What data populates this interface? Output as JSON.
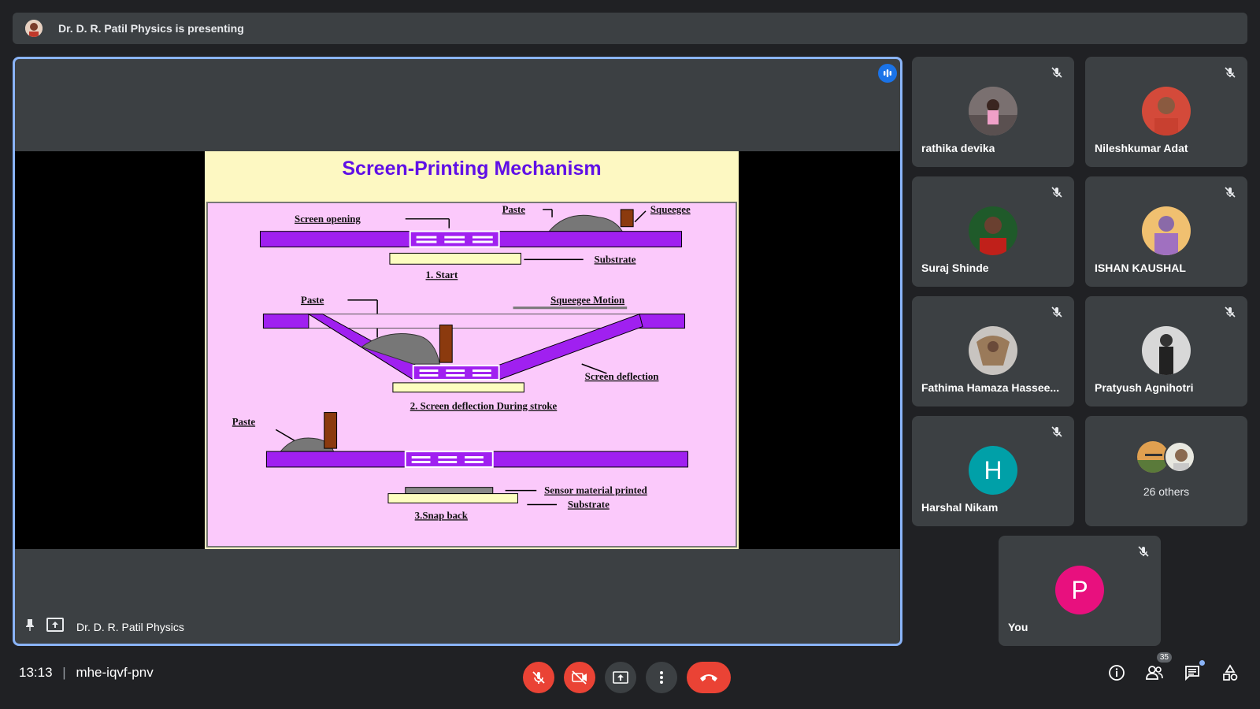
{
  "banner": {
    "text": "Dr. D. R. Patil Physics is presenting"
  },
  "stage": {
    "presenter_name": "Dr. D. R. Patil Physics",
    "slide": {
      "title": "Screen-Printing Mechanism",
      "labels": {
        "screen_opening": "Screen opening",
        "paste1": "Paste",
        "squeegee": "Squeegee",
        "substrate1": "Substrate",
        "step1": "1. Start",
        "paste2": "Paste",
        "squeegee_motion": "Squeegee  Motion",
        "screen_deflection": "Screen deflection",
        "step2": "2. Screen deflection During  stroke",
        "paste3": "Paste",
        "sensor_material": "Sensor material printed",
        "substrate3": "Substrate",
        "step3": "3.Snap back"
      }
    }
  },
  "participants": [
    {
      "name": "rathika devika",
      "avatar": "photo",
      "muted": true
    },
    {
      "name": "Nileshkumar Adat",
      "avatar": "photo",
      "muted": true
    },
    {
      "name": "Suraj Shinde",
      "avatar": "photo",
      "muted": true
    },
    {
      "name": "ISHAN KAUSHAL",
      "avatar": "photo",
      "muted": true
    },
    {
      "name": "Fathima Hamaza Hassee...",
      "avatar": "photo",
      "muted": true
    },
    {
      "name": "Pratyush Agnihotri",
      "avatar": "photo",
      "muted": true
    },
    {
      "name": "Harshal Nikam",
      "avatar": "H",
      "avatar_color": "#00a0a8",
      "muted": true
    },
    {
      "name": "26 others",
      "avatar": "group"
    },
    {
      "name": "You",
      "avatar": "P",
      "avatar_color": "#e8107e",
      "muted": true
    }
  ],
  "bottom_bar": {
    "time": "13:13",
    "separator": "|",
    "meeting_code": "mhe-iqvf-pnv",
    "people_count": "35"
  },
  "colors": {
    "accent": "#8ab4f8",
    "danger": "#ea4335",
    "tile_bg": "#3c4043",
    "slide_title": "#6010e6",
    "screen_purple": "#a020f0"
  }
}
